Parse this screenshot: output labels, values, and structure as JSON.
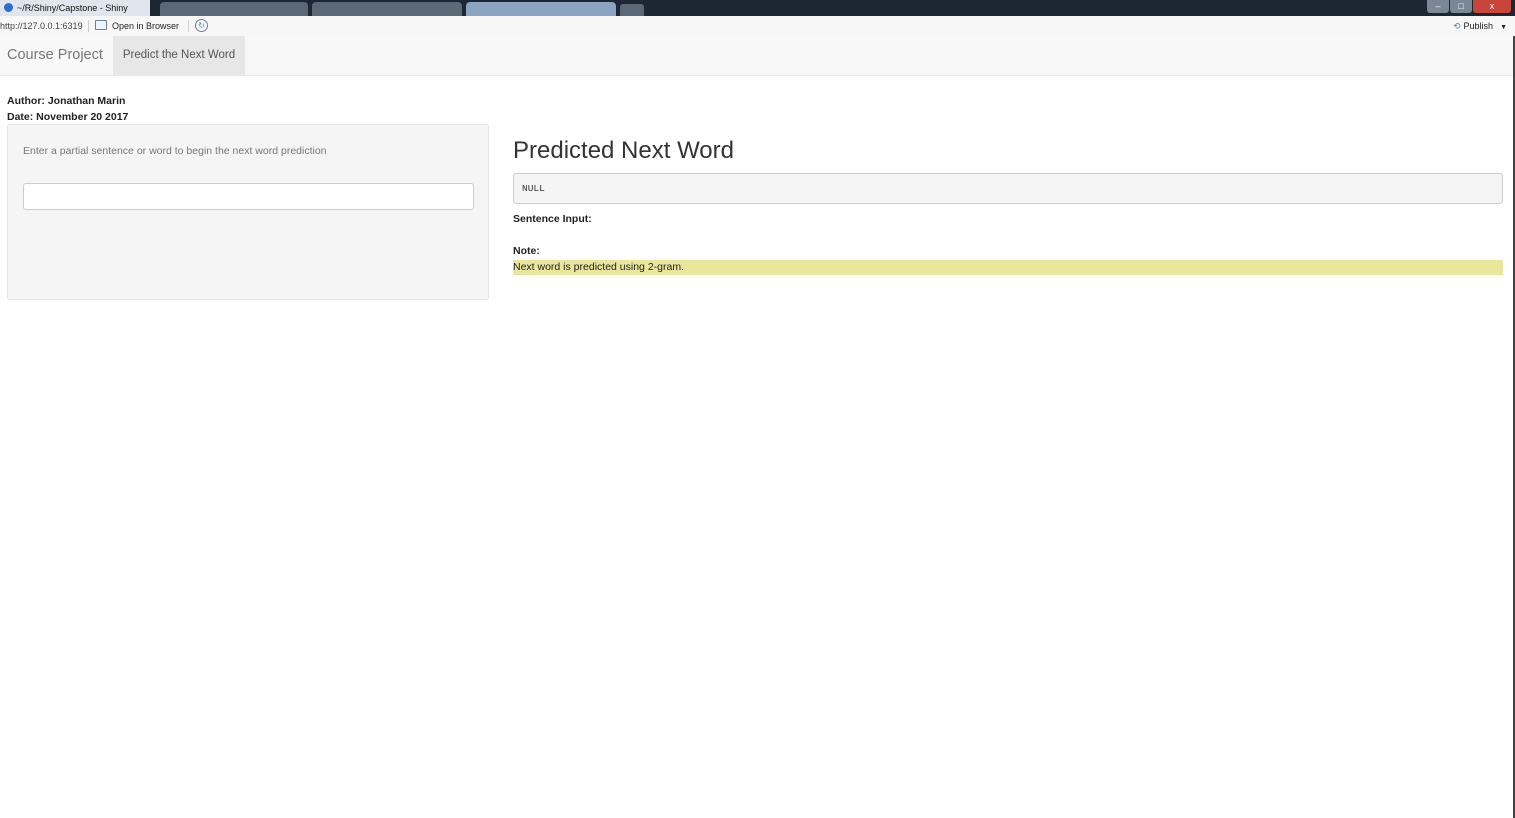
{
  "window": {
    "title": "~/R/Shiny/Capstone - Shiny",
    "min_glyph": "–",
    "max_glyph": "□",
    "close_glyph": "x",
    "tab_placeholder": ""
  },
  "viewer_toolbar": {
    "url": "http://127.0.0.1:6319",
    "open_in_browser": "Open in Browser",
    "refresh_glyph": "↻",
    "publish_glyph": "⟲",
    "publish": "Publish",
    "publish_caret": "▼"
  },
  "navbar": {
    "brand": "Course Project",
    "tabs": [
      {
        "label": "Predict the Next Word",
        "active": true
      }
    ]
  },
  "meta": {
    "author": "Author: Jonathan Marin",
    "date": "Date: November 20 2017"
  },
  "sidebar": {
    "label": "Enter a partial sentence or word to begin the next word prediction",
    "input_value": ""
  },
  "main": {
    "title": "Predicted Next Word",
    "prediction": "NULL",
    "sentence_input_label": "Sentence Input:",
    "note_label": "Note:",
    "note_text": "Next word is predicted using 2-gram."
  },
  "colors": {
    "note_highlight": "#eae79d",
    "navbar_bg": "#f8f8f8",
    "active_tab_bg": "#e7e7e7",
    "well_bg": "#f5f5f5"
  }
}
